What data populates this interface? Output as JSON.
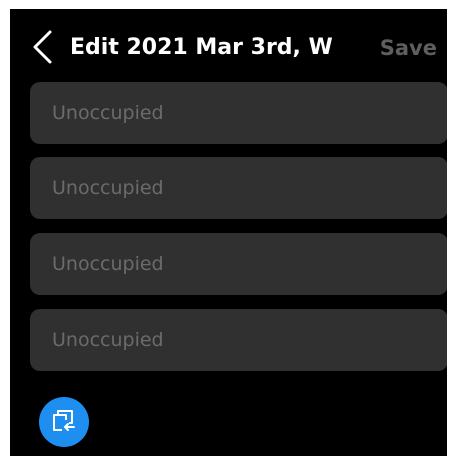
{
  "header": {
    "back_icon": "chevron-left-icon",
    "title": "Edit 2021 Mar 3rd, W",
    "save_label": "Save"
  },
  "slots": [
    {
      "label": "Unoccupied"
    },
    {
      "label": "Unoccupied"
    },
    {
      "label": "Unoccupied"
    },
    {
      "label": "Unoccupied"
    }
  ],
  "copy_button": {
    "icon": "copy-schedule-icon"
  },
  "colors": {
    "background": "#000000",
    "slot_background": "#303030",
    "slot_text": "#6b6b6b",
    "save_disabled": "#5e5e5e",
    "accent": "#1f8ef1"
  }
}
